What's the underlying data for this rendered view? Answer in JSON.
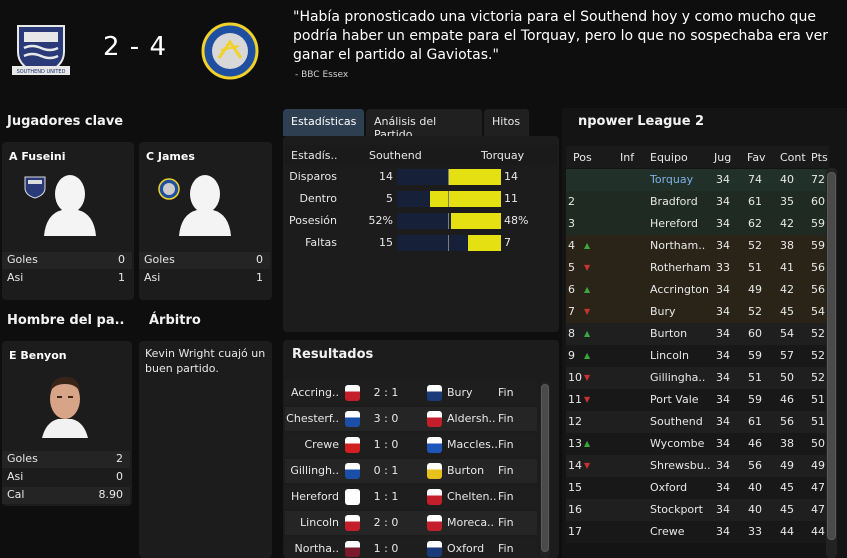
{
  "header": {
    "home_score": "2",
    "away_score": "4",
    "score_separator": "-",
    "home_crest_text": "SOUTHEND UNITED",
    "quote": "\"Había pronosticado una victoria para el Southend hoy y como mucho que podría haber un empate para el Torquay, pero lo que no sospechaba era ver ganar el partido al Gaviotas.\"",
    "quote_source": "- BBC Essex"
  },
  "key_players": {
    "title": "Jugadores clave",
    "home": {
      "name": "A Fuseini",
      "goals_label": "Goles",
      "goals": "0",
      "assists_label": "Asi",
      "assists": "1"
    },
    "away": {
      "name": "C James",
      "goals_label": "Goles",
      "goals": "0",
      "assists_label": "Asi",
      "assists": "1"
    }
  },
  "man_of_match": {
    "title": "Hombre del pa..",
    "name": "E Benyon",
    "goals_label": "Goles",
    "goals": "2",
    "assists_label": "Asi",
    "assists": "0",
    "rating_label": "Cal",
    "rating": "8.90"
  },
  "referee": {
    "title": "Árbitro",
    "comment": "Kevin Wright cuajó un buen partido."
  },
  "tabs": [
    {
      "label": "Estadísticas",
      "active": true
    },
    {
      "label": "Análisis del Partido",
      "active": false
    },
    {
      "label": "Hitos",
      "active": false
    }
  ],
  "stats": {
    "col_stat": "Estadís..",
    "col_home": "Southend",
    "col_away": "Torquay",
    "rows": [
      {
        "label": "Disparos",
        "home": "14",
        "away": "14",
        "home_share": 0.5
      },
      {
        "label": "Dentro",
        "home": "5",
        "away": "11",
        "home_share": 0.3125
      },
      {
        "label": "Posesión",
        "home": "52%",
        "away": "48%",
        "home_share": 0.52
      },
      {
        "label": "Faltas",
        "home": "15",
        "away": "7",
        "home_share": 0.68
      }
    ]
  },
  "results": {
    "title": "Resultados",
    "rows": [
      {
        "home": "Accring..",
        "score": "2 : 1",
        "away": "Bury",
        "status": "Fin",
        "home_color": "#c41e2a",
        "away_color": "#1a3a7a"
      },
      {
        "home": "Chesterf..",
        "score": "3 : 0",
        "away": "Aldersh..",
        "status": "Fin",
        "home_color": "#1a4ea8",
        "away_color": "#c41e2a"
      },
      {
        "home": "Crewe",
        "score": "1 : 0",
        "away": "Maccles..",
        "status": "Fin",
        "home_color": "#d02020",
        "away_color": "#1d56b8"
      },
      {
        "home": "Gillingh..",
        "score": "0 : 1",
        "away": "Burton",
        "status": "Fin",
        "home_color": "#1a4ea8",
        "away_color": "#e8c21a"
      },
      {
        "home": "Hereford",
        "score": "1 : 1",
        "away": "Chelten..",
        "status": "Fin",
        "home_color": "#ffffff",
        "away_color": "#c41e2a"
      },
      {
        "home": "Lincoln",
        "score": "2 : 0",
        "away": "Morecа..",
        "status": "Fin",
        "home_color": "#c41e2a",
        "away_color": "#c41e2a"
      },
      {
        "home": "Northa..",
        "score": "1 : 0",
        "away": "Oxford",
        "status": "Fin",
        "home_color": "#7a1a2a",
        "away_color": "#1a3a7a"
      }
    ]
  },
  "league": {
    "title": "npower League 2",
    "columns": [
      "Pos",
      "Inf",
      "Equipo",
      "Jug",
      "Fav",
      "Cont",
      "Pts"
    ],
    "rows": [
      {
        "pos": "",
        "move": "",
        "team": "Torquay",
        "played": "34",
        "for": "74",
        "against": "40",
        "pts": "72",
        "highlight": "selected"
      },
      {
        "pos": "2",
        "move": "",
        "team": "Bradford",
        "played": "34",
        "for": "61",
        "against": "35",
        "pts": "60",
        "highlight": "promo"
      },
      {
        "pos": "3",
        "move": "",
        "team": "Hereford",
        "played": "34",
        "for": "62",
        "against": "42",
        "pts": "59",
        "highlight": "promo"
      },
      {
        "pos": "4",
        "move": "up",
        "team": "Northam..",
        "played": "34",
        "for": "52",
        "against": "38",
        "pts": "59",
        "highlight": "playoff"
      },
      {
        "pos": "5",
        "move": "down",
        "team": "Rotherham",
        "played": "33",
        "for": "51",
        "against": "41",
        "pts": "56",
        "highlight": "playoff"
      },
      {
        "pos": "6",
        "move": "up",
        "team": "Accrington",
        "played": "34",
        "for": "49",
        "against": "42",
        "pts": "56",
        "highlight": "playoff"
      },
      {
        "pos": "7",
        "move": "down",
        "team": "Bury",
        "played": "34",
        "for": "52",
        "against": "45",
        "pts": "54",
        "highlight": "playoff"
      },
      {
        "pos": "8",
        "move": "up",
        "team": "Burton",
        "played": "34",
        "for": "60",
        "against": "54",
        "pts": "52",
        "highlight": ""
      },
      {
        "pos": "9",
        "move": "up",
        "team": "Lincoln",
        "played": "34",
        "for": "59",
        "against": "57",
        "pts": "52",
        "highlight": ""
      },
      {
        "pos": "10",
        "move": "down",
        "team": "Gillingha..",
        "played": "34",
        "for": "51",
        "against": "50",
        "pts": "52",
        "highlight": ""
      },
      {
        "pos": "11",
        "move": "down",
        "team": "Port Vale",
        "played": "34",
        "for": "59",
        "against": "46",
        "pts": "51",
        "highlight": ""
      },
      {
        "pos": "12",
        "move": "",
        "team": "Southend",
        "played": "34",
        "for": "61",
        "against": "56",
        "pts": "51",
        "highlight": ""
      },
      {
        "pos": "13",
        "move": "up",
        "team": "Wycombe",
        "played": "34",
        "for": "46",
        "against": "38",
        "pts": "50",
        "highlight": ""
      },
      {
        "pos": "14",
        "move": "down",
        "team": "Shrewsbu..",
        "played": "34",
        "for": "56",
        "against": "49",
        "pts": "49",
        "highlight": ""
      },
      {
        "pos": "15",
        "move": "",
        "team": "Oxford",
        "played": "34",
        "for": "40",
        "against": "45",
        "pts": "47",
        "highlight": ""
      },
      {
        "pos": "16",
        "move": "",
        "team": "Stockport",
        "played": "34",
        "for": "40",
        "against": "45",
        "pts": "47",
        "highlight": ""
      },
      {
        "pos": "17",
        "move": "",
        "team": "Crewe",
        "played": "34",
        "for": "33",
        "against": "44",
        "pts": "44",
        "highlight": ""
      }
    ]
  }
}
